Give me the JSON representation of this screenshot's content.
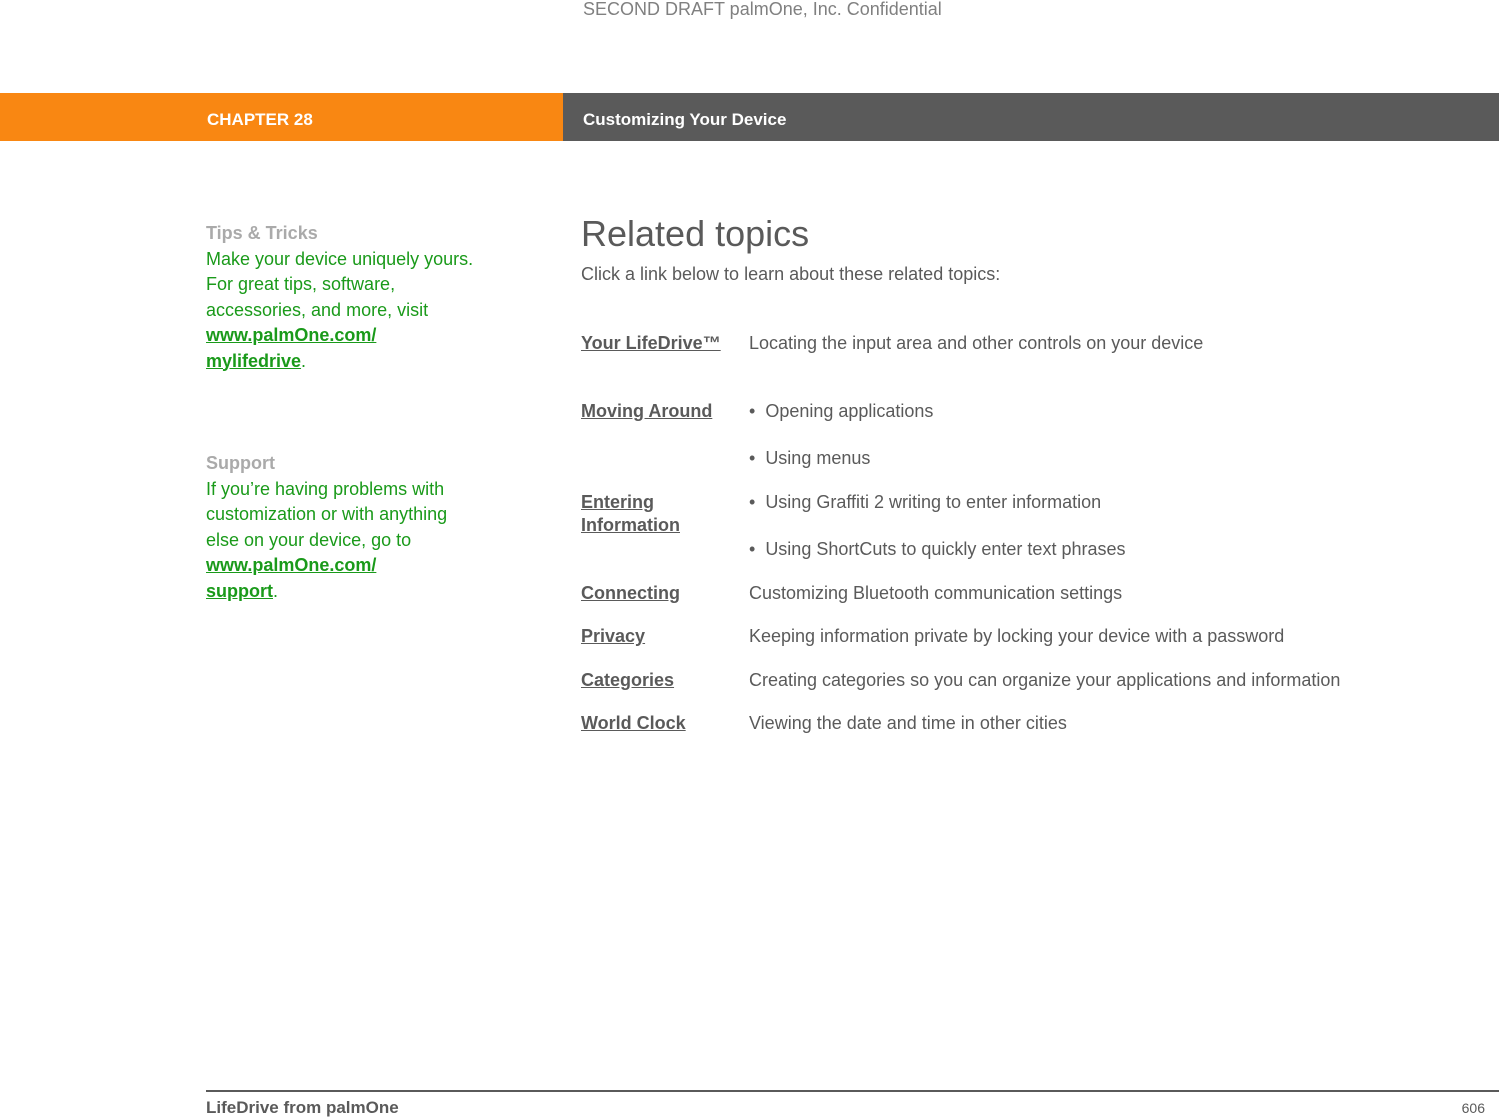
{
  "watermark": "SECOND DRAFT palmOne, Inc.  Confidential",
  "header": {
    "chapter": "CHAPTER 28",
    "title": "Customizing Your Device",
    "colors": {
      "chapter_bg": "#f98712",
      "title_bg": "#5a5a5a"
    }
  },
  "sidebar": {
    "tips": {
      "heading": "Tips & Tricks",
      "text": "Make your device uniquely yours. For great tips, software, accessories, and more, visit",
      "link_line1": "www.palmOne.com/",
      "link_line2": "mylifedrive",
      "suffix": "."
    },
    "support": {
      "heading": "Support",
      "text": "If you’re having problems with customization or with anything else on your device, go to",
      "link_line1": "www.palmOne.com/",
      "link_line2": "support",
      "suffix": "."
    }
  },
  "main": {
    "title": "Related topics",
    "intro": "Click a link below to learn about these related topics:",
    "topics": [
      {
        "link": "Your LifeDrive™",
        "description": "Locating the input area and other controls on your device"
      },
      {
        "link": "Moving Around",
        "bullets": [
          "Opening applications",
          "Using menus"
        ]
      },
      {
        "link": "Entering Information",
        "bullets": [
          "Using Graffiti 2 writing to enter information",
          "Using ShortCuts to quickly enter text phrases"
        ]
      },
      {
        "link": "Connecting",
        "description": "Customizing Bluetooth communication settings"
      },
      {
        "link": "Privacy",
        "description": "Keeping information private by locking your device with a password"
      },
      {
        "link": "Categories",
        "description": "Creating categories so you can organize your applications and information"
      },
      {
        "link": "World Clock",
        "description": "Viewing the date and time in other cities"
      }
    ]
  },
  "footer": {
    "book": "LifeDrive from palmOne",
    "page": "606"
  }
}
